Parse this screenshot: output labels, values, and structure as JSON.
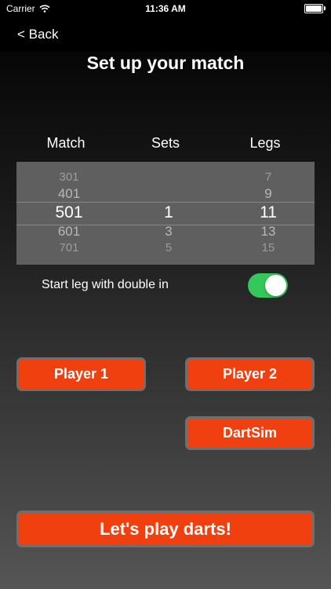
{
  "status_bar": {
    "carrier": "Carrier",
    "time": "11:36 AM"
  },
  "nav": {
    "back": "< Back"
  },
  "title": "Set up your match",
  "picker": {
    "headers": [
      "Match",
      "Sets",
      "Legs"
    ],
    "match": {
      "values": [
        "301",
        "401",
        "501",
        "601",
        "701"
      ],
      "selected": "501"
    },
    "sets": {
      "values": [
        "",
        "",
        "1",
        "3",
        "5"
      ],
      "selected": "1"
    },
    "legs": {
      "values": [
        "7",
        "9",
        "11",
        "13",
        "15"
      ],
      "selected": "11"
    }
  },
  "double_in": {
    "label": "Start leg with double in",
    "enabled": true
  },
  "buttons": {
    "player1": "Player 1",
    "player2": "Player 2",
    "dartsim": "DartSim",
    "play": "Let's play darts!"
  },
  "colors": {
    "accent": "#f04010",
    "toggle_on": "#34c759"
  }
}
